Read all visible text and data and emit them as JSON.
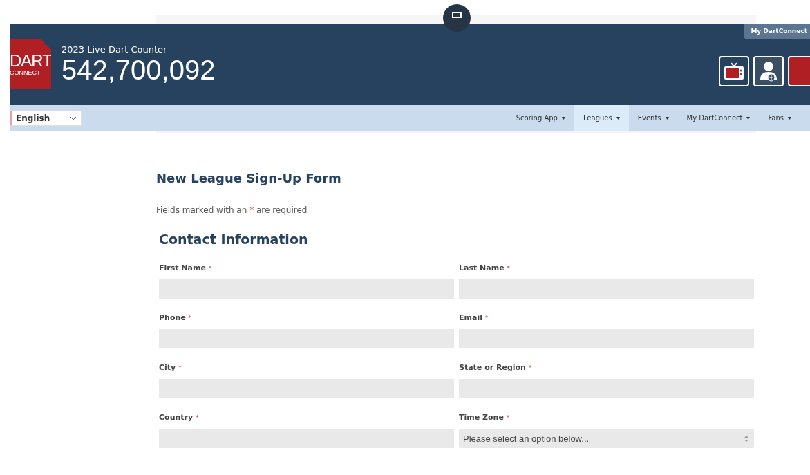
{
  "logo": {
    "line_1": "DART",
    "line_2": "CONNECT"
  },
  "counter": {
    "caption": "2023 Live Dart Counter",
    "value": "542,700,092"
  },
  "account_tab": "My DartConnect",
  "language_select": {
    "value": "English"
  },
  "nav": [
    {
      "label": "Scoring App",
      "selected": false
    },
    {
      "label": "Leagues",
      "selected": true
    },
    {
      "label": "Events",
      "selected": false
    },
    {
      "label": "My DartConnect",
      "selected": false
    },
    {
      "label": "Fans",
      "selected": false
    }
  ],
  "form": {
    "title": "New League Sign-Up Form",
    "note": {
      "before": "Fields marked with an",
      "mark": "*",
      "after": "are required"
    },
    "section": "Contact Information",
    "fields": [
      {
        "label": "First Name",
        "required_mark": "*",
        "kind": "text"
      },
      {
        "label": "Last Name",
        "required_mark": "*",
        "kind": "text"
      },
      {
        "label": "Phone",
        "required_mark": "*",
        "kind": "text"
      },
      {
        "label": "Email",
        "required_mark": "*",
        "kind": "text"
      },
      {
        "label": "City",
        "required_mark": "*",
        "kind": "text"
      },
      {
        "label": "State or Region",
        "required_mark": "*",
        "kind": "text"
      },
      {
        "label": "Country",
        "required_mark": "*",
        "kind": "text"
      },
      {
        "label": "Time Zone",
        "required_mark": "*",
        "kind": "select",
        "placeholder": "Please select an option below..."
      }
    ]
  }
}
